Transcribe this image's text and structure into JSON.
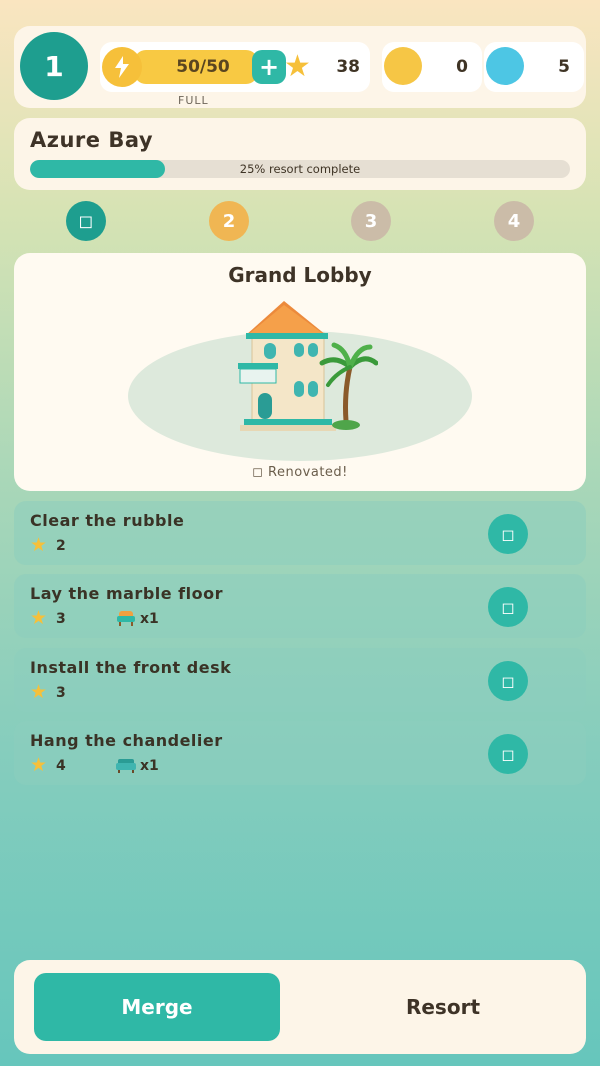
{
  "player": {
    "level": "1"
  },
  "resources": {
    "energy": {
      "value": "50/50",
      "status": "FULL",
      "plus": "+",
      "icon": "lightning-icon"
    },
    "stars": "38",
    "coins": "0",
    "gems": "5"
  },
  "location": {
    "name": "Azure Bay",
    "progress_text": "25% resort complete",
    "progress_fraction": 0.25
  },
  "stages": [
    {
      "label": "◻",
      "state": "done"
    },
    {
      "label": "2",
      "state": "current"
    },
    {
      "label": "3",
      "state": "locked"
    },
    {
      "label": "4",
      "state": "locked"
    }
  ],
  "room": {
    "title": "Grand Lobby",
    "status": "◻ Renovated!"
  },
  "tasks": [
    {
      "name": "Clear the rubble",
      "cost": "2",
      "item_icon": "",
      "item_qty": "",
      "action": "◻"
    },
    {
      "name": "Lay the marble floor",
      "cost": "3",
      "item_icon": "armchair-icon",
      "item_qty": "x1",
      "action": "◻"
    },
    {
      "name": "Install the front desk",
      "cost": "3",
      "item_icon": "",
      "item_qty": "",
      "action": "◻"
    },
    {
      "name": "Hang the chandelier",
      "cost": "4",
      "item_icon": "sofa-icon",
      "item_qty": "x1",
      "action": "◻"
    }
  ],
  "nav": {
    "merge": "Merge",
    "resort": "Resort"
  },
  "colors": {
    "accent": "#2fb8a6",
    "level_badge": "#1e9e8f",
    "gold": "#f6c03a",
    "gem": "#4dc6e4",
    "stage_current": "#f0b653",
    "stage_locked": "#cbbca8"
  }
}
